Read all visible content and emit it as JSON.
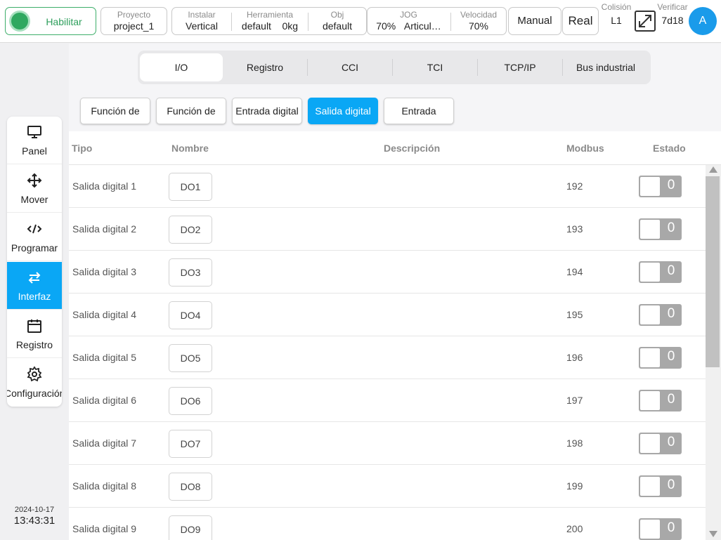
{
  "header": {
    "enable_label": "Habilitar",
    "proyecto": {
      "title": "Proyecto",
      "value": "project_1"
    },
    "instalar": {
      "title": "Instalar",
      "value": "Vertical"
    },
    "herramienta": {
      "title": "Herramienta",
      "value": "default",
      "extra": "0kg"
    },
    "obj": {
      "title": "Obj",
      "value": "default"
    },
    "jog": {
      "title": "JOG",
      "value": "70%",
      "extra": "Articul…"
    },
    "velocidad": {
      "title": "Velocidad",
      "value": "70%"
    },
    "manual_label": "Manual",
    "real_label": "Real",
    "colision": {
      "title": "Colisión",
      "value": "L1"
    },
    "verificar": {
      "title": "Verificar",
      "value": "7d18"
    },
    "avatar_letter": "A"
  },
  "sidebar": {
    "items": [
      {
        "label": "Panel",
        "icon": "monitor-icon"
      },
      {
        "label": "Mover",
        "icon": "move-arrows-icon"
      },
      {
        "label": "Programar",
        "icon": "code-icon"
      },
      {
        "label": "Interfaz",
        "icon": "swap-arrows-icon",
        "active": true
      },
      {
        "label": "Registro",
        "icon": "calendar-icon"
      },
      {
        "label": "Configuración",
        "icon": "gear-icon"
      }
    ],
    "date": "2024-10-17",
    "time": "13:43:31"
  },
  "tabs": [
    "I/O",
    "Registro",
    "CCI",
    "TCI",
    "TCP/IP",
    "Bus industrial"
  ],
  "subtabs": [
    "Función de",
    "Función de",
    "Entrada digital",
    "Salida digital",
    "Entrada"
  ],
  "table": {
    "headers": {
      "tipo": "Tipo",
      "nombre": "Nombre",
      "descripcion": "Descripción",
      "modbus": "Modbus",
      "estado": "Estado"
    },
    "rows": [
      {
        "tipo": "Salida digital 1",
        "nombre": "DO1",
        "modbus": "192",
        "estado": "0"
      },
      {
        "tipo": "Salida digital 2",
        "nombre": "DO2",
        "modbus": "193",
        "estado": "0"
      },
      {
        "tipo": "Salida digital 3",
        "nombre": "DO3",
        "modbus": "194",
        "estado": "0"
      },
      {
        "tipo": "Salida digital 4",
        "nombre": "DO4",
        "modbus": "195",
        "estado": "0"
      },
      {
        "tipo": "Salida digital 5",
        "nombre": "DO5",
        "modbus": "196",
        "estado": "0"
      },
      {
        "tipo": "Salida digital 6",
        "nombre": "DO6",
        "modbus": "197",
        "estado": "0"
      },
      {
        "tipo": "Salida digital 7",
        "nombre": "DO7",
        "modbus": "198",
        "estado": "0"
      },
      {
        "tipo": "Salida digital 8",
        "nombre": "DO8",
        "modbus": "199",
        "estado": "0"
      },
      {
        "tipo": "Salida digital 9",
        "nombre": "DO9",
        "modbus": "200",
        "estado": "0"
      }
    ]
  },
  "colors": {
    "accent": "#0aa7f5",
    "enable_green": "#2fa860",
    "toggle_off": "#a8a8a8"
  }
}
